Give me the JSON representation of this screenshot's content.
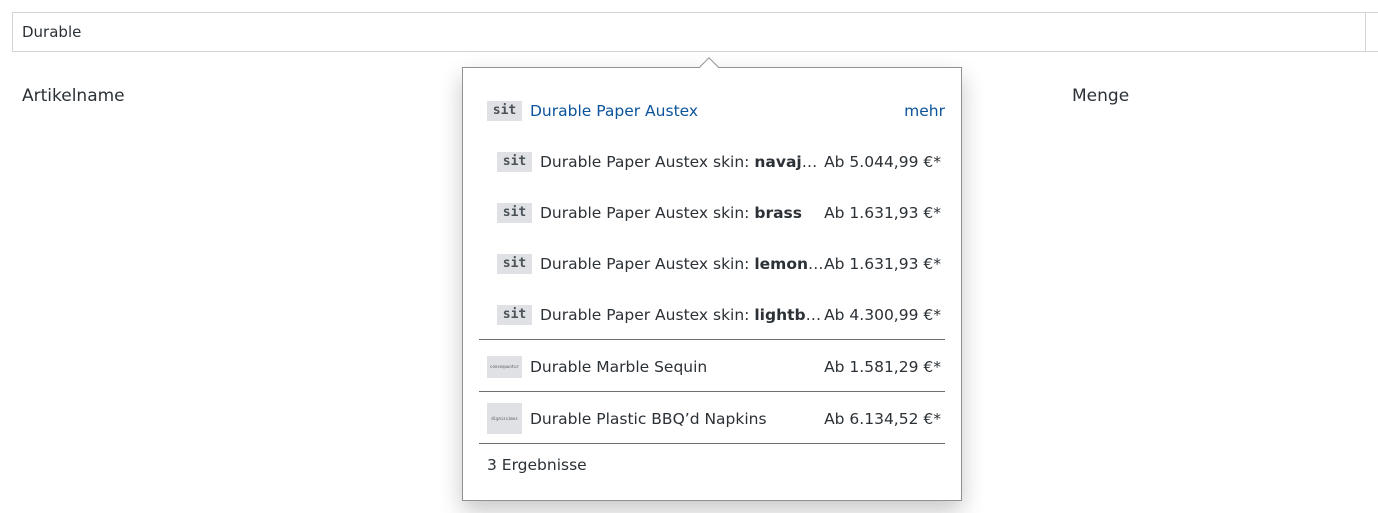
{
  "search": {
    "value": "Durable"
  },
  "table_headers": {
    "article": "Artikelname",
    "quantity": "Menge"
  },
  "dropdown": {
    "main_item": {
      "thumb": "sit",
      "name": "Durable Paper Austex",
      "more": "mehr"
    },
    "variants": [
      {
        "thumb": "sit",
        "prefix": "Durable Paper Austex skin: ",
        "option": "navajo...",
        "price": "Ab 5.044,99 €*"
      },
      {
        "thumb": "sit",
        "prefix": "Durable Paper Austex skin: ",
        "option": "brass",
        "price": "Ab 1.631,93 €*"
      },
      {
        "thumb": "sit",
        "prefix": "Durable Paper Austex skin: ",
        "option": "lemonch...",
        "price": "Ab 1.631,93 €*"
      },
      {
        "thumb": "sit",
        "prefix": "Durable Paper Austex skin: ",
        "option": "lightblue",
        "price": "Ab 4.300,99 €*"
      }
    ],
    "products": [
      {
        "thumb": "consequuntur",
        "name": "Durable Marble Sequin",
        "price": "Ab 1.581,29 €*"
      },
      {
        "thumb": "dignissimos",
        "name": "Durable Plastic BBQ’d Napkins",
        "price": "Ab 6.134,52 €*"
      }
    ],
    "result_count": "3 Ergebnisse"
  },
  "colors": {
    "link": "#0b539b",
    "text": "#2b3136",
    "border": "#d1d5d9",
    "thumb_bg": "#dfe1e5"
  }
}
